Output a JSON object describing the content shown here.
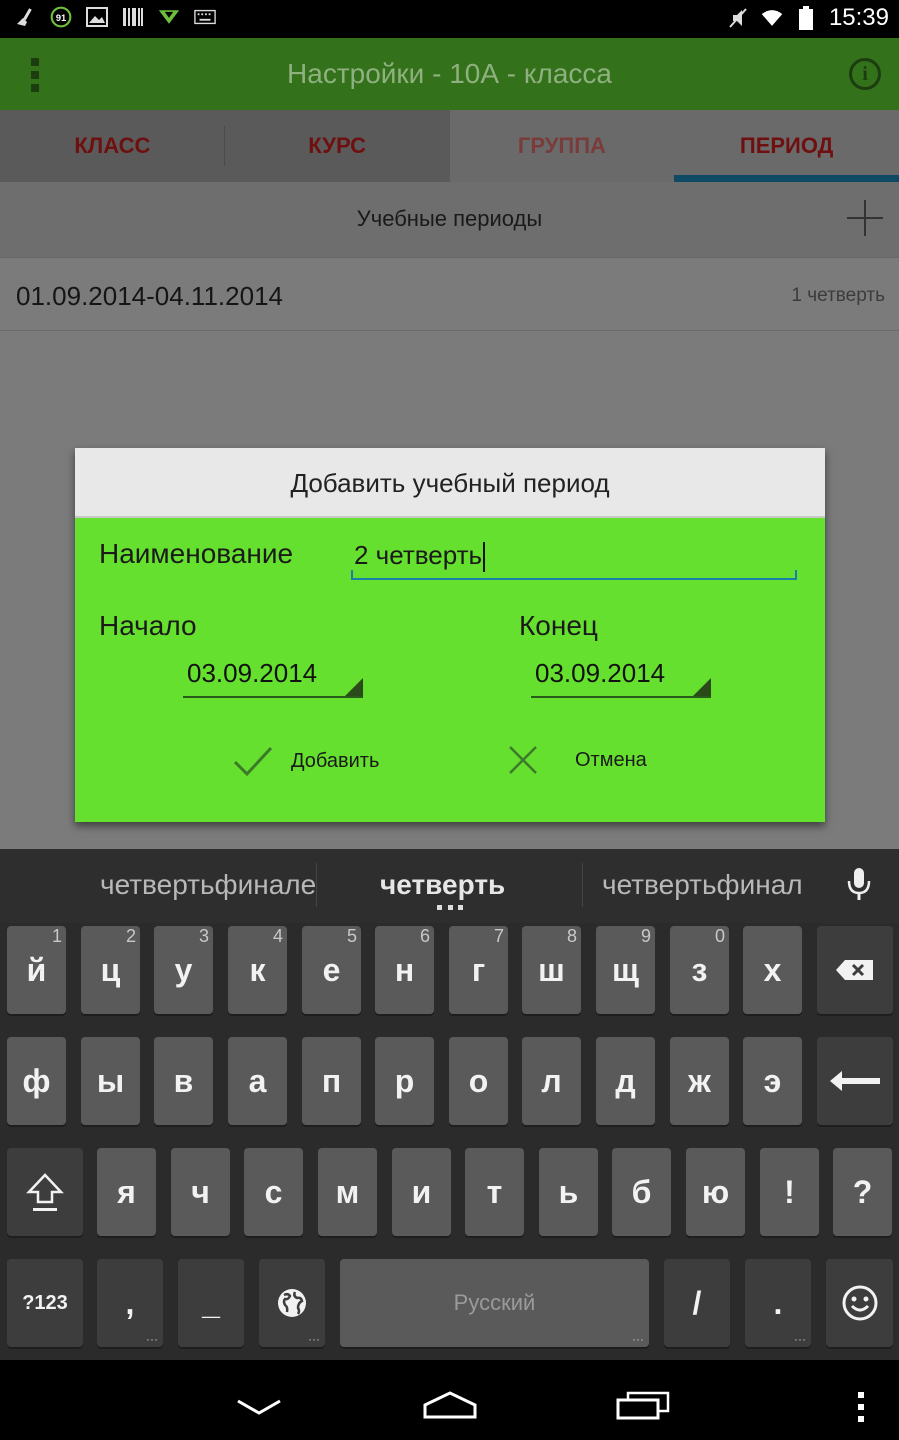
{
  "status_bar": {
    "left_icons": [
      "broom-icon",
      "battery-91-icon",
      "image-icon",
      "barcode-icon",
      "download-icon",
      "keyboard-icon"
    ],
    "notification_badge": "91",
    "right_icons": [
      "mute-icon",
      "wifi-icon",
      "battery-icon"
    ],
    "time": "15:39"
  },
  "action_bar": {
    "title": "Настройки - 10А - класса",
    "menu_icon": "overflow-menu-icon",
    "info_icon": "info-icon",
    "info_glyph": "i"
  },
  "tabs": [
    {
      "label": "КЛАСС"
    },
    {
      "label": "КУРС"
    },
    {
      "label": "ГРУППА"
    },
    {
      "label": "ПЕРИОД",
      "active": true
    }
  ],
  "section": {
    "title": "Учебные периоды",
    "add_icon": "plus-icon"
  },
  "periods": [
    {
      "dates": "01.09.2014-04.11.2014",
      "name": "1 четверть"
    }
  ],
  "dialog": {
    "title": "Добавить учебный период",
    "name_label": "Наименование",
    "name_value": "2 четверть",
    "start_label": "Начало",
    "start_value": "03.09.2014",
    "end_label": "Конец",
    "end_value": "03.09.2014",
    "add_label": "Добавить",
    "cancel_label": "Отмена"
  },
  "keyboard": {
    "suggestions": [
      "четвертьфинале",
      "четверть",
      "четвертьфинал"
    ],
    "row1": [
      {
        "k": "й",
        "n": "1"
      },
      {
        "k": "ц",
        "n": "2"
      },
      {
        "k": "у",
        "n": "3"
      },
      {
        "k": "к",
        "n": "4"
      },
      {
        "k": "е",
        "n": "5"
      },
      {
        "k": "н",
        "n": "6"
      },
      {
        "k": "г",
        "n": "7"
      },
      {
        "k": "ш",
        "n": "8"
      },
      {
        "k": "щ",
        "n": "9"
      },
      {
        "k": "з",
        "n": "0"
      },
      {
        "k": "х",
        "n": ""
      }
    ],
    "row2": [
      "ф",
      "ы",
      "в",
      "а",
      "п",
      "р",
      "о",
      "л",
      "д",
      "ж",
      "э"
    ],
    "row3": [
      "я",
      "ч",
      "с",
      "м",
      "и",
      "т",
      "ь",
      "б",
      "ю",
      "!",
      "?"
    ],
    "symbols_key": "?123",
    "comma_key": ",",
    "underscore_key": "_",
    "space_label": "Русский",
    "slash_key": "/",
    "period_key": ".",
    "backspace_icon": "backspace-icon",
    "enter_icon": "enter-icon",
    "shift_icon": "shift-icon",
    "globe_icon": "globe-icon",
    "emoji_icon": "emoji-icon",
    "mic_icon": "microphone-icon"
  },
  "nav_bar": {
    "icons": [
      "back-down-icon",
      "home-icon",
      "recents-icon",
      "overflow-menu-icon"
    ]
  },
  "colors": {
    "dialog_body": "#65e02e",
    "action_bar_dim": "#33711b",
    "tab_text": "#6f1010",
    "active_tab_indicator": "#0e4a63",
    "input_underline": "#1a7fa8"
  }
}
